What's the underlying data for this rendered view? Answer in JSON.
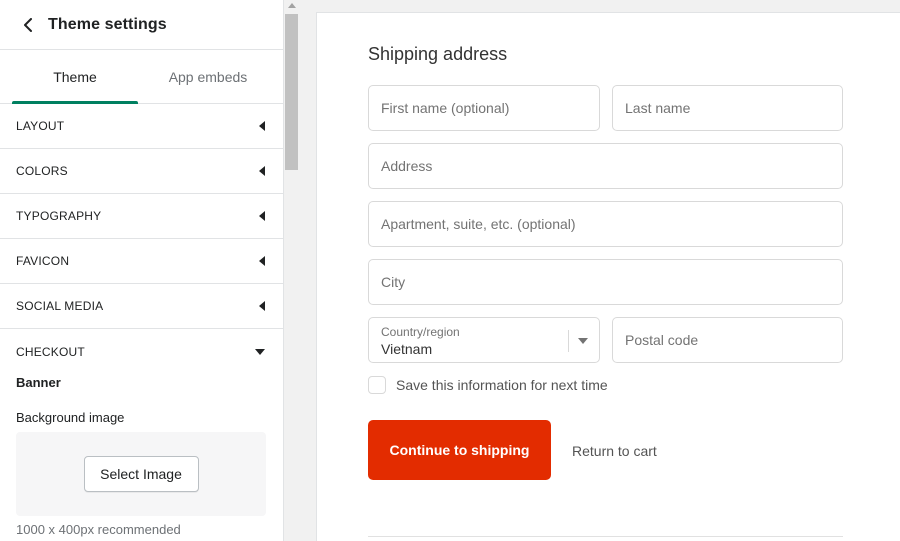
{
  "sidebar": {
    "title": "Theme settings",
    "tabs": [
      {
        "label": "Theme",
        "active": true
      },
      {
        "label": "App embeds",
        "active": false
      }
    ],
    "sections": [
      {
        "label": "LAYOUT"
      },
      {
        "label": "COLORS"
      },
      {
        "label": "TYPOGRAPHY"
      },
      {
        "label": "FAVICON"
      },
      {
        "label": "SOCIAL MEDIA"
      },
      {
        "label": "CHECKOUT",
        "open": true
      }
    ],
    "checkout": {
      "banner_heading": "Banner",
      "background_image_label": "Background image",
      "select_image_label": "Select Image",
      "hint": "1000 x 400px recommended"
    },
    "accent_color": "#008060"
  },
  "preview": {
    "title": "Shipping address",
    "fields": {
      "first_name_placeholder": "First name (optional)",
      "last_name_placeholder": "Last name",
      "address_placeholder": "Address",
      "apartment_placeholder": "Apartment, suite, etc. (optional)",
      "city_placeholder": "City",
      "country_label": "Country/region",
      "country_value": "Vietnam",
      "postal_placeholder": "Postal code"
    },
    "save_info_label": "Save this information for next time",
    "continue_label": "Continue to shipping",
    "return_label": "Return to cart",
    "button_color": "#e32c00"
  }
}
